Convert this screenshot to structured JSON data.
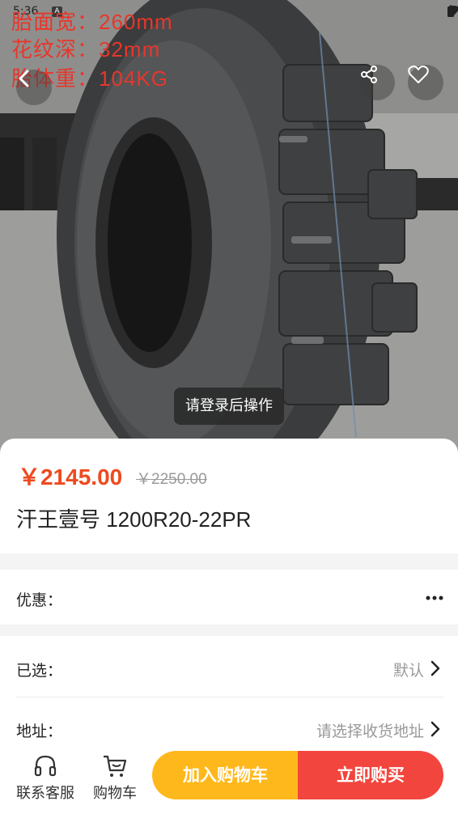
{
  "status_bar": {
    "time": "5:36",
    "notification_badge": "A"
  },
  "overlay": {
    "line1": "胎面宽：260mm",
    "line2": "花纹深：32mm",
    "line3": "胎体重：104KG"
  },
  "toast": "请登录后操作",
  "product": {
    "price": "￥2145.00",
    "original_price": "￥2250.00",
    "title": "汗王壹号 1200R20-22PR"
  },
  "discount": {
    "label": "优惠："
  },
  "selected": {
    "label": "已选：",
    "value": "默认"
  },
  "address": {
    "label": "地址：",
    "value": "请选择收货地址"
  },
  "bottom_bar": {
    "service_label": "联系客服",
    "cart_label": "购物车",
    "add_to_cart": "加入购物车",
    "buy_now": "立即购买"
  },
  "colors": {
    "price": "#ee4a1f",
    "add_to_cart": "#ffb81c",
    "buy_now": "#f2453d",
    "overlay_text": "#e8362c"
  }
}
